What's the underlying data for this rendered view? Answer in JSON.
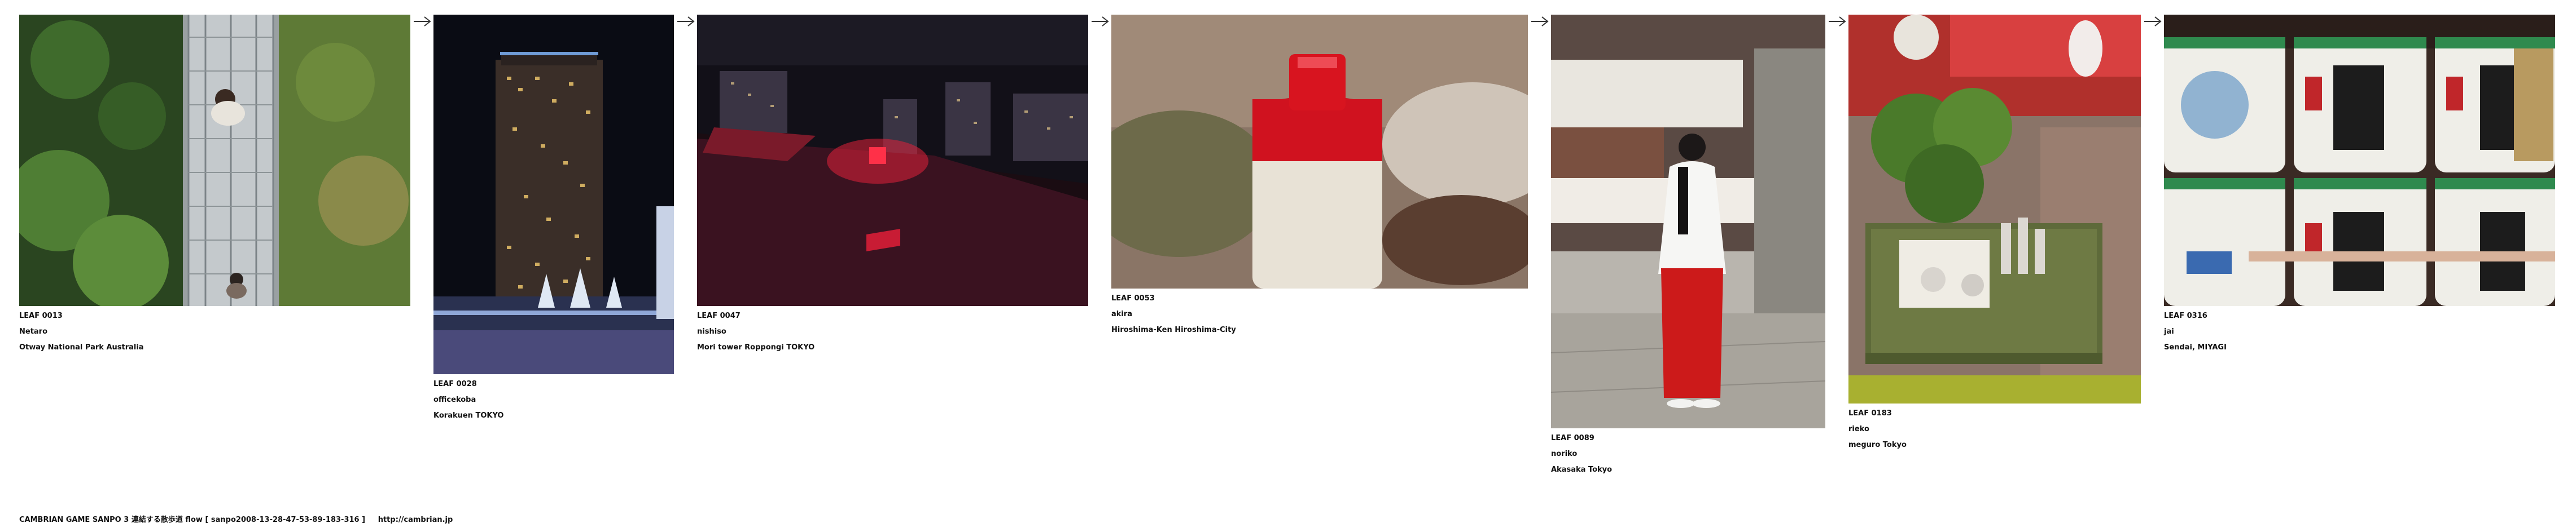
{
  "leaves": [
    {
      "id": "LEAF 0013",
      "author": "Netaro",
      "place": "Otway National Park Australia"
    },
    {
      "id": "LEAF 0028",
      "author": "officekoba",
      "place": "Korakuen TOKYO"
    },
    {
      "id": "LEAF 0047",
      "author": "nishiso",
      "place": "Mori tower Roppongi TOKYO"
    },
    {
      "id": "LEAF 0053",
      "author": "akira",
      "place": "Hiroshima-Ken Hiroshima-City"
    },
    {
      "id": "LEAF 0089",
      "author": "noriko",
      "place": "Akasaka Tokyo"
    },
    {
      "id": "LEAF 0183",
      "author": "rieko",
      "place": "meguro Tokyo"
    },
    {
      "id": "LEAF 0316",
      "author": "jai",
      "place": "Sendai, MIYAGI"
    }
  ],
  "footer": {
    "title": "CAMBRIAN GAME  SANPO 3 連結する散歩道 flow [ sanpo2008-13-28-47-53-89-183-316 ]",
    "link": "http://cambrian.jp"
  },
  "colors": {
    "background": "#ffffff",
    "text": "#111111",
    "arrow": "#333333"
  }
}
